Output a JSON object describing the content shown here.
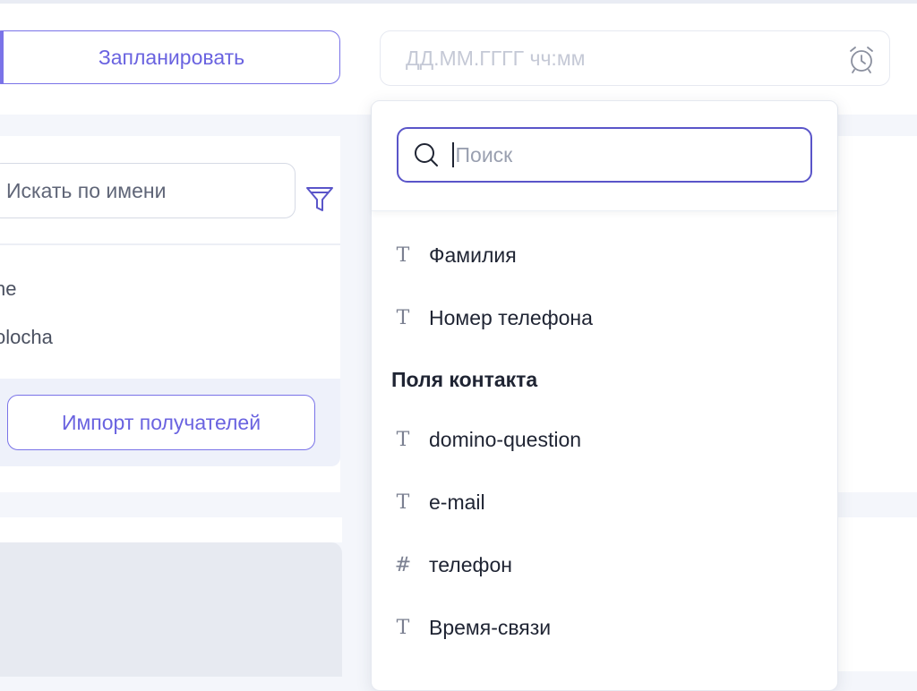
{
  "toolbar": {
    "schedule_label": "Запланировать",
    "datetime_placeholder": "ДД.ММ.ГГГГ чч:мм"
  },
  "recipients": {
    "search_placeholder": "Искать по имени",
    "items": [
      "he",
      "olocha"
    ],
    "import_label": "Импорт получателей"
  },
  "dropdown": {
    "search_placeholder": "Поиск",
    "options": [
      {
        "icon": "text",
        "glyph": "T",
        "label": "Фамилия"
      },
      {
        "icon": "text",
        "glyph": "T",
        "label": "Номер телефона"
      }
    ],
    "group_header": "Поля контакта",
    "contact_fields": [
      {
        "icon": "text",
        "glyph": "T",
        "label": "domino-question"
      },
      {
        "icon": "text",
        "glyph": "T",
        "label": "e-mail"
      },
      {
        "icon": "number",
        "glyph": "#",
        "label": "телефон"
      },
      {
        "icon": "text",
        "glyph": "T",
        "label": "Время-связи"
      }
    ]
  },
  "colors": {
    "accent": "#6a63e0",
    "text": "#1f2433",
    "muted": "#9aa0b0"
  }
}
